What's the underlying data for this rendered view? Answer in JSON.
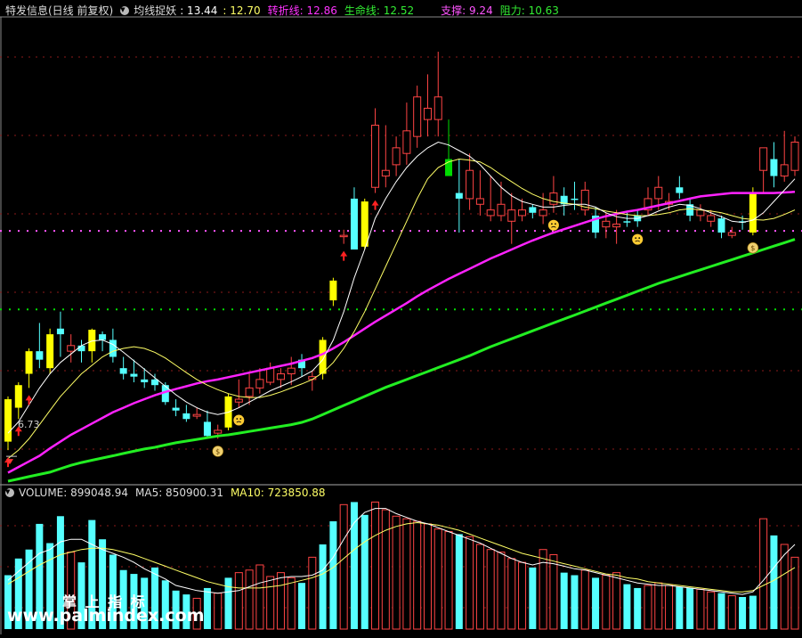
{
  "header": {
    "stock_title": "特发信息(日线 前复权)",
    "indicator_name": "均线捉妖",
    "ind_val1": ": 13.44",
    "ind_val2": ": 12.70",
    "zhuanzhe_label": "转折线",
    "zhuanzhe_value": ": 12.86",
    "shengming_label": "生命线",
    "shengming_value": ": 12.52",
    "zhicheng_label": "支撑",
    "zhicheng_value": ": 9.24",
    "zuli_label": "阻力",
    "zuli_value": ": 10.63"
  },
  "volume_header": {
    "vol_label": "VOLUME",
    "vol_value": ": 899048.94",
    "ma5_label": "MA5",
    "ma5_value": ": 850900.31",
    "ma10_label": "MA10",
    "ma10_value": ": 723850.88"
  },
  "low_label": "6.73",
  "watermark": {
    "line1": "掌  上  指  标",
    "line2": "www.palmindex.com"
  },
  "colors": {
    "up_cyan": "#55ffff",
    "up_yellow": "#ffff00",
    "down_red": "#ff4444",
    "green_bar": "#00dd00",
    "magenta": "#ff22ff",
    "life_green": "#22ee22",
    "support_dots": "#00dd00",
    "resist_dots": "#ff55ff",
    "ma_white": "#ffffff",
    "ma_yellow": "#ffff66"
  },
  "chart_data": {
    "type": "candlestick",
    "y_price_range": [
      6.2,
      14.4
    ],
    "support": 9.24,
    "resist": 10.63,
    "candles": [
      {
        "o": 6.9,
        "h": 7.7,
        "l": 6.75,
        "c": 7.65,
        "k": "yu"
      },
      {
        "o": 7.5,
        "h": 7.95,
        "l": 7.3,
        "c": 7.9,
        "k": "yu"
      },
      {
        "o": 8.1,
        "h": 8.55,
        "l": 7.85,
        "c": 8.5,
        "k": "yu"
      },
      {
        "o": 8.35,
        "h": 9.0,
        "l": 8.2,
        "c": 8.5,
        "k": "cu"
      },
      {
        "o": 8.2,
        "h": 8.9,
        "l": 8.1,
        "c": 8.8,
        "k": "yu"
      },
      {
        "o": 8.8,
        "h": 9.2,
        "l": 8.4,
        "c": 8.9,
        "k": "cu"
      },
      {
        "o": 8.6,
        "h": 8.8,
        "l": 8.3,
        "c": 8.5,
        "k": "rd"
      },
      {
        "o": 8.5,
        "h": 8.7,
        "l": 8.3,
        "c": 8.6,
        "k": "cu"
      },
      {
        "o": 8.5,
        "h": 8.9,
        "l": 8.3,
        "c": 8.88,
        "k": "yu"
      },
      {
        "o": 8.8,
        "h": 8.85,
        "l": 8.5,
        "c": 8.7,
        "k": "cu"
      },
      {
        "o": 8.7,
        "h": 8.9,
        "l": 8.3,
        "c": 8.4,
        "k": "cu"
      },
      {
        "o": 8.2,
        "h": 8.4,
        "l": 8.0,
        "c": 8.1,
        "k": "cu"
      },
      {
        "o": 8.1,
        "h": 8.35,
        "l": 7.95,
        "c": 8.05,
        "k": "cu"
      },
      {
        "o": 8.0,
        "h": 8.2,
        "l": 7.85,
        "c": 7.95,
        "k": "cu"
      },
      {
        "o": 8.0,
        "h": 8.1,
        "l": 7.8,
        "c": 7.9,
        "k": "cu"
      },
      {
        "o": 7.9,
        "h": 7.95,
        "l": 7.55,
        "c": 7.6,
        "k": "cu"
      },
      {
        "o": 7.5,
        "h": 7.65,
        "l": 7.35,
        "c": 7.45,
        "k": "cu"
      },
      {
        "o": 7.4,
        "h": 7.55,
        "l": 7.25,
        "c": 7.3,
        "k": "cu"
      },
      {
        "o": 7.35,
        "h": 7.5,
        "l": 7.3,
        "c": 7.38,
        "k": "rd"
      },
      {
        "o": 7.25,
        "h": 7.45,
        "l": 6.95,
        "c": 7.0,
        "k": "cu"
      },
      {
        "o": 7.05,
        "h": 7.2,
        "l": 6.95,
        "c": 7.1,
        "k": "rd"
      },
      {
        "o": 7.15,
        "h": 7.75,
        "l": 7.1,
        "c": 7.7,
        "k": "yu"
      },
      {
        "o": 7.6,
        "h": 8.0,
        "l": 7.5,
        "c": 7.65,
        "k": "rd"
      },
      {
        "o": 7.7,
        "h": 8.1,
        "l": 7.55,
        "c": 7.85,
        "k": "rd"
      },
      {
        "o": 7.85,
        "h": 8.2,
        "l": 7.75,
        "c": 8.0,
        "k": "rd"
      },
      {
        "o": 7.95,
        "h": 8.3,
        "l": 7.9,
        "c": 8.2,
        "k": "rd"
      },
      {
        "o": 8.0,
        "h": 8.2,
        "l": 7.85,
        "c": 8.1,
        "k": "rd"
      },
      {
        "o": 8.1,
        "h": 8.4,
        "l": 7.9,
        "c": 8.2,
        "k": "rd"
      },
      {
        "o": 8.2,
        "h": 8.45,
        "l": 8.05,
        "c": 8.35,
        "k": "cu"
      },
      {
        "o": 8.0,
        "h": 8.15,
        "l": 7.8,
        "c": 8.05,
        "k": "rd"
      },
      {
        "o": 8.1,
        "h": 8.75,
        "l": 8.0,
        "c": 8.7,
        "k": "yu"
      },
      {
        "o": 9.4,
        "h": 9.8,
        "l": 9.3,
        "c": 9.75,
        "k": "yu"
      },
      {
        "o": 10.55,
        "h": 10.65,
        "l": 10.4,
        "c": 10.55,
        "k": "rd"
      },
      {
        "o": 10.3,
        "h": 11.4,
        "l": 10.3,
        "c": 11.2,
        "k": "cu"
      },
      {
        "o": 10.35,
        "h": 11.2,
        "l": 10.3,
        "c": 11.15,
        "k": "yu"
      },
      {
        "o": 11.4,
        "h": 12.8,
        "l": 11.3,
        "c": 12.5,
        "k": "rd"
      },
      {
        "o": 11.6,
        "h": 12.5,
        "l": 11.4,
        "c": 11.7,
        "k": "rd"
      },
      {
        "o": 11.8,
        "h": 12.3,
        "l": 11.6,
        "c": 12.1,
        "k": "rd"
      },
      {
        "o": 12.0,
        "h": 12.9,
        "l": 11.8,
        "c": 12.4,
        "k": "rd"
      },
      {
        "o": 12.3,
        "h": 13.2,
        "l": 12.1,
        "c": 13.0,
        "k": "rd"
      },
      {
        "o": 12.6,
        "h": 13.4,
        "l": 12.3,
        "c": 12.8,
        "k": "rd"
      },
      {
        "o": 12.6,
        "h": 13.8,
        "l": 12.3,
        "c": 13.0,
        "k": "rd"
      },
      {
        "o": 11.9,
        "h": 12.6,
        "l": 11.7,
        "c": 11.6,
        "k": "gd"
      },
      {
        "o": 11.2,
        "h": 11.9,
        "l": 10.6,
        "c": 11.3,
        "k": "cu"
      },
      {
        "o": 11.2,
        "h": 12.0,
        "l": 11.0,
        "c": 11.7,
        "k": "rd"
      },
      {
        "o": 11.2,
        "h": 11.7,
        "l": 10.9,
        "c": 11.1,
        "k": "rd"
      },
      {
        "o": 11.0,
        "h": 11.6,
        "l": 10.8,
        "c": 10.9,
        "k": "rd"
      },
      {
        "o": 10.9,
        "h": 11.5,
        "l": 10.8,
        "c": 11.1,
        "k": "rd"
      },
      {
        "o": 10.8,
        "h": 11.3,
        "l": 10.4,
        "c": 11.0,
        "k": "rd"
      },
      {
        "o": 10.9,
        "h": 11.2,
        "l": 10.8,
        "c": 11.0,
        "k": "rd"
      },
      {
        "o": 10.95,
        "h": 11.1,
        "l": 10.85,
        "c": 11.05,
        "k": "cu"
      },
      {
        "o": 11.0,
        "h": 11.3,
        "l": 10.75,
        "c": 10.9,
        "k": "rd"
      },
      {
        "o": 11.1,
        "h": 11.6,
        "l": 10.95,
        "c": 11.3,
        "k": "rd"
      },
      {
        "o": 11.1,
        "h": 11.4,
        "l": 10.9,
        "c": 11.25,
        "k": "cu"
      },
      {
        "o": 11.2,
        "h": 11.5,
        "l": 11.0,
        "c": 11.2,
        "k": "cu"
      },
      {
        "o": 11.35,
        "h": 11.5,
        "l": 10.9,
        "c": 11.0,
        "k": "rd"
      },
      {
        "o": 10.9,
        "h": 11.05,
        "l": 10.5,
        "c": 10.6,
        "k": "cu"
      },
      {
        "o": 10.7,
        "h": 10.95,
        "l": 10.5,
        "c": 10.8,
        "k": "rd"
      },
      {
        "o": 10.7,
        "h": 11.0,
        "l": 10.4,
        "c": 10.75,
        "k": "rd"
      },
      {
        "o": 10.8,
        "h": 10.95,
        "l": 10.7,
        "c": 10.8,
        "k": "cu"
      },
      {
        "o": 10.8,
        "h": 11.0,
        "l": 10.7,
        "c": 10.9,
        "k": "cu"
      },
      {
        "o": 11.0,
        "h": 11.4,
        "l": 10.9,
        "c": 11.2,
        "k": "rd"
      },
      {
        "o": 11.2,
        "h": 11.6,
        "l": 11.0,
        "c": 11.4,
        "k": "rd"
      },
      {
        "o": 11.1,
        "h": 11.3,
        "l": 11.0,
        "c": 11.15,
        "k": "rd"
      },
      {
        "o": 11.3,
        "h": 11.6,
        "l": 11.2,
        "c": 11.4,
        "k": "cu"
      },
      {
        "o": 11.1,
        "h": 11.2,
        "l": 10.8,
        "c": 10.9,
        "k": "cu"
      },
      {
        "o": 11.0,
        "h": 11.1,
        "l": 10.8,
        "c": 10.9,
        "k": "rd"
      },
      {
        "o": 10.9,
        "h": 11.0,
        "l": 10.7,
        "c": 10.8,
        "k": "rd"
      },
      {
        "o": 10.85,
        "h": 10.9,
        "l": 10.5,
        "c": 10.6,
        "k": "cu"
      },
      {
        "o": 10.6,
        "h": 10.7,
        "l": 10.5,
        "c": 10.55,
        "k": "rd"
      },
      {
        "o": 10.8,
        "h": 10.9,
        "l": 10.65,
        "c": 10.8,
        "k": "cu"
      },
      {
        "o": 10.6,
        "h": 11.4,
        "l": 10.55,
        "c": 11.3,
        "k": "yu"
      },
      {
        "o": 11.7,
        "h": 12.1,
        "l": 11.3,
        "c": 12.1,
        "k": "rd"
      },
      {
        "o": 11.6,
        "h": 12.2,
        "l": 11.4,
        "c": 11.9,
        "k": "cu"
      },
      {
        "o": 11.6,
        "h": 12.4,
        "l": 11.5,
        "c": 11.8,
        "k": "rd"
      },
      {
        "o": 11.7,
        "h": 12.3,
        "l": 11.6,
        "c": 12.2,
        "k": "rd"
      }
    ],
    "ma_white": [
      7.05,
      7.25,
      7.55,
      7.85,
      8.1,
      8.3,
      8.45,
      8.6,
      8.68,
      8.7,
      8.62,
      8.48,
      8.33,
      8.18,
      8.03,
      7.88,
      7.73,
      7.6,
      7.5,
      7.42,
      7.38,
      7.42,
      7.5,
      7.6,
      7.7,
      7.8,
      7.88,
      7.96,
      8.05,
      8.15,
      8.35,
      8.7,
      9.2,
      9.8,
      10.3,
      10.85,
      11.2,
      11.5,
      11.75,
      11.95,
      12.1,
      12.2,
      12.15,
      12.05,
      11.95,
      11.8,
      11.6,
      11.4,
      11.25,
      11.15,
      11.1,
      11.05,
      11.05,
      11.08,
      11.1,
      11.1,
      11.05,
      10.95,
      10.88,
      10.85,
      10.85,
      10.9,
      10.98,
      11.05,
      11.1,
      11.08,
      11.02,
      10.95,
      10.88,
      10.8,
      10.78,
      10.82,
      10.95,
      11.15,
      11.35,
      11.55
    ],
    "ma_yellow": [
      6.6,
      6.75,
      6.95,
      7.2,
      7.45,
      7.7,
      7.9,
      8.1,
      8.25,
      8.4,
      8.5,
      8.55,
      8.58,
      8.55,
      8.48,
      8.38,
      8.25,
      8.12,
      8.0,
      7.9,
      7.82,
      7.75,
      7.7,
      7.68,
      7.68,
      7.72,
      7.78,
      7.85,
      7.92,
      8.0,
      8.12,
      8.3,
      8.55,
      8.85,
      9.2,
      9.6,
      10.0,
      10.4,
      10.8,
      11.2,
      11.55,
      11.75,
      11.85,
      11.9,
      11.88,
      11.85,
      11.75,
      11.62,
      11.5,
      11.38,
      11.28,
      11.2,
      11.15,
      11.12,
      11.1,
      11.05,
      11.02,
      10.98,
      10.95,
      10.92,
      10.9,
      10.9,
      10.92,
      10.95,
      11.0,
      11.02,
      11.0,
      10.98,
      10.95,
      10.9,
      10.85,
      10.83,
      10.82,
      10.85,
      10.92,
      11.0
    ],
    "ma_magenta": [
      6.35,
      6.45,
      6.55,
      6.65,
      6.78,
      6.9,
      7.02,
      7.12,
      7.22,
      7.32,
      7.42,
      7.5,
      7.58,
      7.65,
      7.72,
      7.78,
      7.83,
      7.88,
      7.93,
      7.97,
      8.0,
      8.04,
      8.08,
      8.12,
      8.16,
      8.2,
      8.24,
      8.28,
      8.33,
      8.38,
      8.45,
      8.55,
      8.66,
      8.78,
      8.9,
      9.02,
      9.13,
      9.24,
      9.35,
      9.47,
      9.58,
      9.68,
      9.78,
      9.87,
      9.96,
      10.05,
      10.14,
      10.22,
      10.3,
      10.38,
      10.46,
      10.53,
      10.6,
      10.66,
      10.72,
      10.78,
      10.84,
      10.89,
      10.93,
      10.97,
      11.0,
      11.04,
      11.08,
      11.12,
      11.16,
      11.2,
      11.24,
      11.26,
      11.28,
      11.3,
      11.3,
      11.3,
      11.3,
      11.3,
      11.31,
      11.32
    ],
    "ma_green": [
      6.2,
      6.24,
      6.28,
      6.32,
      6.36,
      6.42,
      6.48,
      6.53,
      6.57,
      6.61,
      6.65,
      6.69,
      6.73,
      6.77,
      6.8,
      6.84,
      6.88,
      6.91,
      6.94,
      6.97,
      7.0,
      7.02,
      7.05,
      7.08,
      7.11,
      7.14,
      7.17,
      7.2,
      7.24,
      7.3,
      7.38,
      7.46,
      7.54,
      7.62,
      7.7,
      7.78,
      7.86,
      7.93,
      8.0,
      8.07,
      8.14,
      8.21,
      8.28,
      8.35,
      8.42,
      8.5,
      8.58,
      8.65,
      8.72,
      8.79,
      8.86,
      8.93,
      9.0,
      9.07,
      9.14,
      9.21,
      9.28,
      9.35,
      9.42,
      9.49,
      9.56,
      9.63,
      9.7,
      9.76,
      9.82,
      9.88,
      9.94,
      10.0,
      10.06,
      10.12,
      10.18,
      10.24,
      10.3,
      10.36,
      10.42,
      10.48
    ],
    "volume": [
      0.42,
      0.55,
      0.62,
      0.82,
      0.67,
      0.88,
      0.6,
      0.52,
      0.85,
      0.7,
      0.58,
      0.46,
      0.43,
      0.4,
      0.48,
      0.38,
      0.3,
      0.27,
      0.24,
      0.32,
      0.28,
      0.4,
      0.44,
      0.46,
      0.5,
      0.41,
      0.44,
      0.4,
      0.36,
      0.56,
      0.66,
      0.84,
      0.97,
      0.99,
      0.89,
      0.99,
      0.93,
      0.88,
      0.86,
      0.84,
      0.82,
      0.78,
      0.76,
      0.74,
      0.72,
      0.66,
      0.62,
      0.6,
      0.55,
      0.52,
      0.48,
      0.62,
      0.58,
      0.44,
      0.42,
      0.46,
      0.4,
      0.42,
      0.44,
      0.35,
      0.32,
      0.34,
      0.36,
      0.34,
      0.33,
      0.32,
      0.31,
      0.29,
      0.28,
      0.26,
      0.25,
      0.26,
      0.86,
      0.73,
      0.66,
      0.56
    ],
    "vol_ma5": [
      0.38,
      0.45,
      0.52,
      0.59,
      0.62,
      0.68,
      0.7,
      0.7,
      0.66,
      0.62,
      0.59,
      0.56,
      0.52,
      0.47,
      0.43,
      0.39,
      0.34,
      0.32,
      0.3,
      0.29,
      0.28,
      0.29,
      0.3,
      0.33,
      0.36,
      0.38,
      0.4,
      0.41,
      0.41,
      0.42,
      0.46,
      0.56,
      0.7,
      0.83,
      0.91,
      0.94,
      0.94,
      0.9,
      0.87,
      0.84,
      0.82,
      0.79,
      0.76,
      0.73,
      0.7,
      0.67,
      0.63,
      0.59,
      0.55,
      0.52,
      0.5,
      0.52,
      0.51,
      0.49,
      0.47,
      0.46,
      0.44,
      0.42,
      0.4,
      0.38,
      0.36,
      0.35,
      0.34,
      0.34,
      0.33,
      0.32,
      0.31,
      0.3,
      0.29,
      0.28,
      0.27,
      0.29,
      0.38,
      0.48,
      0.58,
      0.66
    ],
    "vol_ma10": [
      0.35,
      0.4,
      0.45,
      0.5,
      0.54,
      0.58,
      0.6,
      0.62,
      0.63,
      0.63,
      0.62,
      0.6,
      0.58,
      0.55,
      0.52,
      0.49,
      0.46,
      0.43,
      0.4,
      0.37,
      0.35,
      0.33,
      0.32,
      0.32,
      0.32,
      0.33,
      0.34,
      0.36,
      0.38,
      0.4,
      0.43,
      0.48,
      0.55,
      0.62,
      0.68,
      0.73,
      0.77,
      0.8,
      0.82,
      0.83,
      0.82,
      0.81,
      0.79,
      0.77,
      0.74,
      0.71,
      0.68,
      0.65,
      0.62,
      0.59,
      0.57,
      0.55,
      0.53,
      0.51,
      0.49,
      0.47,
      0.45,
      0.43,
      0.42,
      0.4,
      0.39,
      0.37,
      0.36,
      0.35,
      0.34,
      0.33,
      0.32,
      0.31,
      0.3,
      0.29,
      0.29,
      0.3,
      0.34,
      0.38,
      0.43,
      0.48
    ],
    "markers": {
      "up_arrows": [
        0,
        1,
        2,
        32,
        35
      ],
      "smiley": [
        22,
        52,
        60
      ],
      "money_bag": [
        20,
        71
      ],
      "start_marker": 0
    }
  }
}
